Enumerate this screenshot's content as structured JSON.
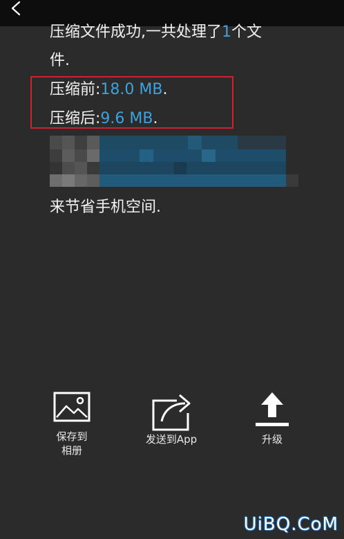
{
  "header": {
    "back_icon": "chevron-left-icon"
  },
  "message": {
    "line1_prefix": "压缩文件成功,一共处理了",
    "line1_count": "1",
    "line1_suffix": "个文",
    "line2": "件.",
    "before_label": "压缩前:",
    "before_value": "18.0 MB",
    "before_end": ".",
    "after_label": "压缩后:",
    "after_value": "9.6 MB",
    "after_end": ".",
    "closing": "来节省手机空间."
  },
  "actions": [
    {
      "label": "保存到\n相册",
      "icon": "image-icon"
    },
    {
      "label": "发送到App",
      "icon": "share-icon"
    },
    {
      "label": "升级",
      "icon": "upload-icon"
    }
  ],
  "watermark": "UiBQ.CoM",
  "colors": {
    "background": "#2b2b2b",
    "topbar": "#0d0d0d",
    "accent": "#3aa3e0",
    "highlight": "#d2232c"
  }
}
